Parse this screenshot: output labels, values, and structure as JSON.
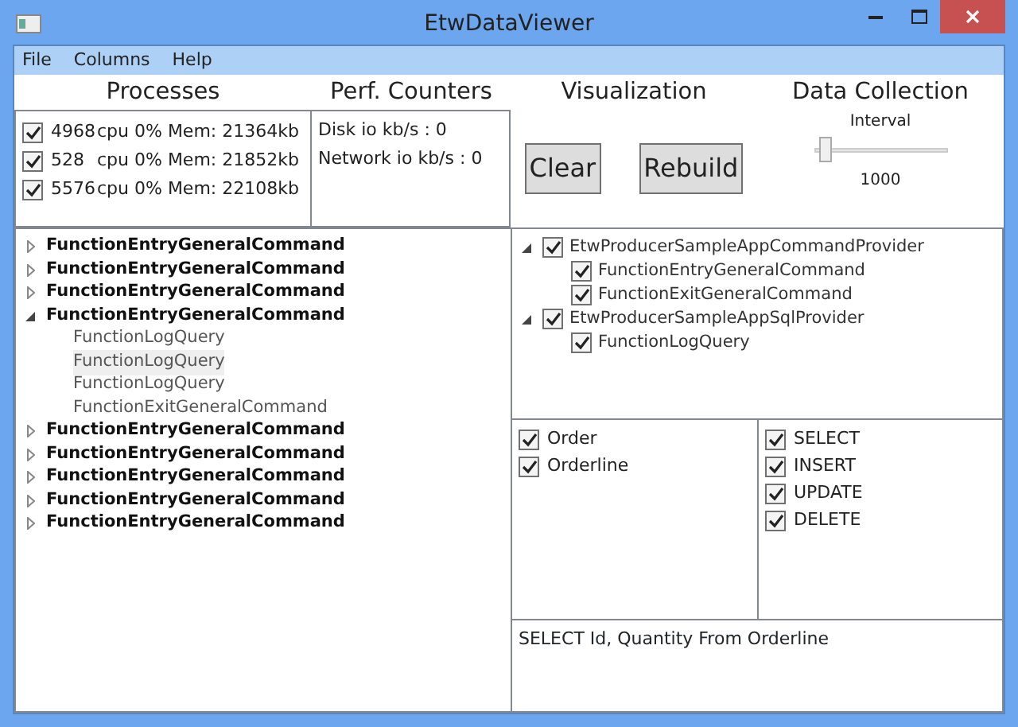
{
  "window": {
    "title": "EtwDataViewer"
  },
  "menu": [
    "File",
    "Columns",
    "Help"
  ],
  "processes": {
    "title": "Processes",
    "items": [
      {
        "checked": true,
        "pid": "4968",
        "info": "cpu 0% Mem: 21364kb"
      },
      {
        "checked": true,
        "pid": "528",
        "info": "cpu 0% Mem: 21852kb"
      },
      {
        "checked": true,
        "pid": "5576",
        "info": "cpu 0% Mem: 22108kb"
      }
    ]
  },
  "perf_counters": {
    "title": "Perf. Counters",
    "items": [
      "Disk io kb/s : 0",
      "Network io kb/s : 0"
    ]
  },
  "visualization": {
    "title": "Visualization",
    "buttons": [
      "Clear",
      "Rebuild"
    ]
  },
  "data_collection": {
    "title": "Data Collection",
    "interval_label": "Interval",
    "level": 0.05,
    "value": "1000"
  },
  "event_tree": [
    {
      "label": "FunctionEntryGeneralCommand",
      "expanded": false
    },
    {
      "label": "FunctionEntryGeneralCommand",
      "expanded": false
    },
    {
      "label": "FunctionEntryGeneralCommand",
      "expanded": false
    },
    {
      "label": "FunctionEntryGeneralCommand",
      "expanded": true,
      "children": [
        {
          "label": "FunctionLogQuery",
          "selected": false
        },
        {
          "label": "FunctionLogQuery",
          "selected": true
        },
        {
          "label": "FunctionLogQuery",
          "selected": false
        },
        {
          "label": "FunctionExitGeneralCommand",
          "selected": false
        }
      ]
    },
    {
      "label": "FunctionEntryGeneralCommand",
      "expanded": false
    },
    {
      "label": "FunctionEntryGeneralCommand",
      "expanded": false
    },
    {
      "label": "FunctionEntryGeneralCommand",
      "expanded": false
    },
    {
      "label": "FunctionEntryGeneralCommand",
      "expanded": false
    },
    {
      "label": "FunctionEntryGeneralCommand",
      "expanded": false
    }
  ],
  "providers": [
    {
      "label": "EtwProducerSampleAppCommandProvider",
      "checked": true,
      "expanded": true,
      "children": [
        {
          "label": "FunctionEntryGeneralCommand",
          "checked": true
        },
        {
          "label": "FunctionExitGeneralCommand",
          "checked": true
        }
      ]
    },
    {
      "label": "EtwProducerSampleAppSqlProvider",
      "checked": true,
      "expanded": true,
      "children": [
        {
          "label": "FunctionLogQuery",
          "checked": true
        }
      ]
    }
  ],
  "tables": [
    {
      "label": "Order",
      "checked": true
    },
    {
      "label": "Orderline",
      "checked": true
    }
  ],
  "operations": [
    {
      "label": "SELECT",
      "checked": true
    },
    {
      "label": "INSERT",
      "checked": true
    },
    {
      "label": "UPDATE",
      "checked": true
    },
    {
      "label": "DELETE",
      "checked": true
    }
  ],
  "query": "SELECT Id, Quantity From Orderline"
}
